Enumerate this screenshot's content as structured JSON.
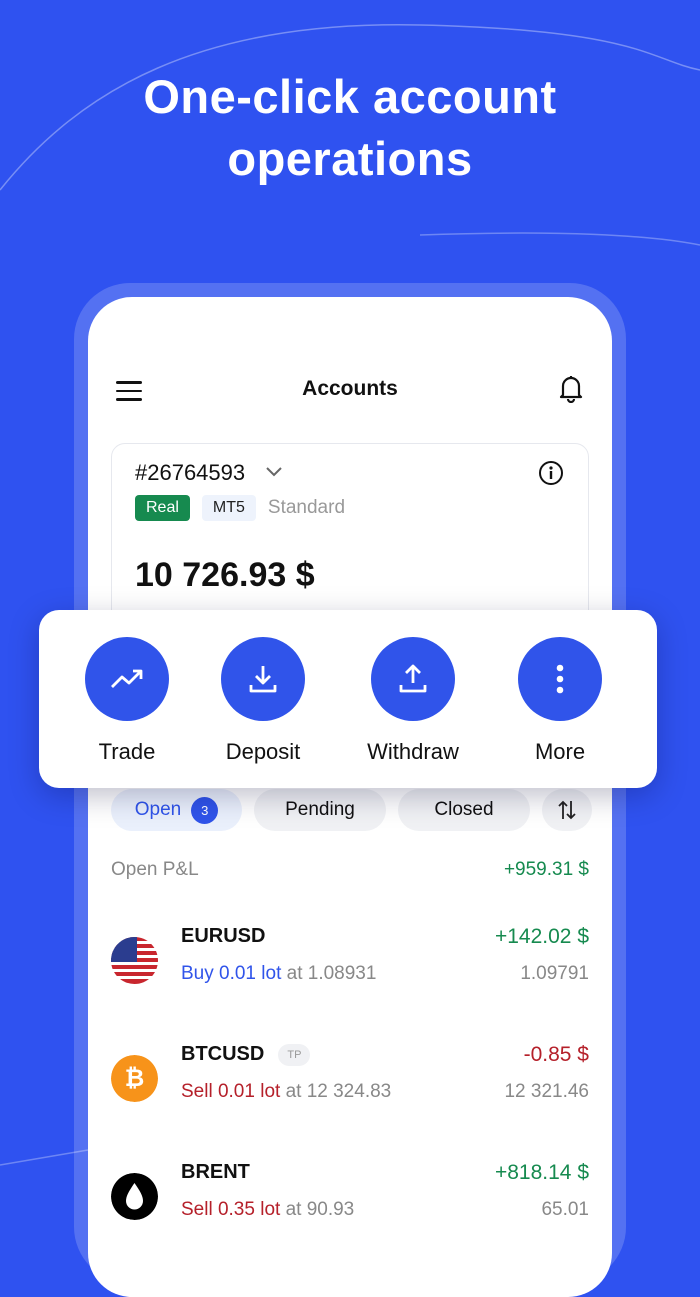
{
  "headline": {
    "line1": "One-click account",
    "line2": "operations"
  },
  "header": {
    "title": "Accounts",
    "menu_icon": "hamburger-icon",
    "bell_icon": "bell-icon"
  },
  "account": {
    "number": "#26764593",
    "tags": {
      "type": "Real",
      "platform": "MT5",
      "kind": "Standard"
    },
    "balance": "10 726.93 $"
  },
  "actions": [
    {
      "label": "Trade",
      "icon": "trend-up-icon"
    },
    {
      "label": "Deposit",
      "icon": "download-icon"
    },
    {
      "label": "Withdraw",
      "icon": "upload-icon"
    },
    {
      "label": "More",
      "icon": "more-vertical-icon"
    }
  ],
  "tabs": {
    "open": "Open",
    "open_count": "3",
    "pending": "Pending",
    "closed": "Closed"
  },
  "pnl": {
    "label": "Open P&L",
    "value": "+959.31 $"
  },
  "positions": [
    {
      "symbol": "EURUSD",
      "side": "Buy 0.01 lot",
      "at": " at 1.08931",
      "pl": "+142.02 $",
      "price": "1.09791"
    },
    {
      "symbol": "BTCUSD",
      "badge": "TP",
      "side": "Sell 0.01 lot",
      "at": " at 12 324.83",
      "pl": "-0.85 $",
      "price": "12 321.46"
    },
    {
      "symbol": "BRENT",
      "side": "Sell 0.35 lot",
      "at": " at 90.93",
      "pl": "+818.14 $",
      "price": "65.01"
    }
  ],
  "colors": {
    "background": "#2f52f0",
    "accent": "#3054ea",
    "profit": "#168a4f",
    "loss": "#b5202a"
  }
}
